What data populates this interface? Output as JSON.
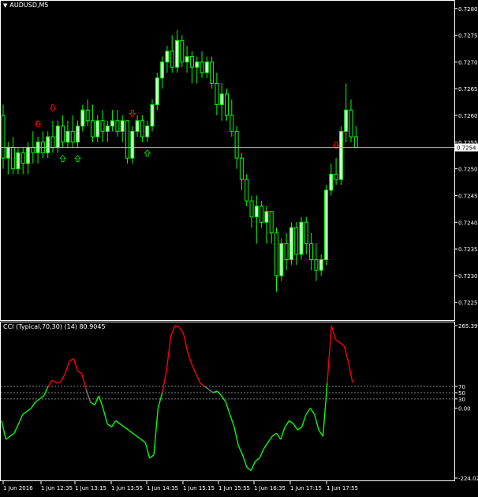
{
  "window": {
    "symbol_label": "AUDUSD,M5",
    "indicator_label": "CCI (Typical,70,30) (14) 80.9045",
    "current_price": "0.7254"
  },
  "colors": {
    "background": "#000000",
    "bull_candle": "#ccffcc",
    "bear_candle": "#000000",
    "wick": "#00ff00",
    "cci_low": "#00ff00",
    "cci_high": "#ff0000",
    "cci_mid": "#808080",
    "grid": "#ffffff",
    "arrow_up": "#00cc00",
    "arrow_down": "#ff0000"
  },
  "icons": {
    "up_arrow": "arrow-up-outline-icon",
    "down_arrow": "arrow-down-outline-icon"
  },
  "price_axis": [
    "0.7280",
    "0.7275",
    "0.7270",
    "0.7265",
    "0.7260",
    "0.7255",
    "0.7250",
    "0.7245",
    "0.7240",
    "0.7235",
    "0.7230",
    "0.7225"
  ],
  "cci_axis": [
    "265.3926",
    "70",
    "50",
    "30",
    "0.00",
    "-224.0247"
  ],
  "time_axis": [
    "1 Jun 2016",
    "1 Jun 12:35",
    "1 Jun 13:15",
    "1 Jun 13:55",
    "1 Jun 14:35",
    "1 Jun 15:15",
    "1 Jun 15:55",
    "1 Jun 16:35",
    "1 Jun 17:15",
    "1 Jun 17:55"
  ],
  "chart_data": [
    {
      "type": "candlestick",
      "symbol": "AUDUSD",
      "timeframe": "M5",
      "ylim": [
        0.7222,
        0.7281
      ],
      "current_price": 0.7254,
      "candles": [
        [
          0.726,
          0.7262,
          0.725,
          0.7252
        ],
        [
          0.7252,
          0.7255,
          0.7249,
          0.7254
        ],
        [
          0.7254,
          0.7256,
          0.7249,
          0.725
        ],
        [
          0.725,
          0.7254,
          0.7249,
          0.7253
        ],
        [
          0.7253,
          0.7254,
          0.7249,
          0.7251
        ],
        [
          0.7251,
          0.7255,
          0.7249,
          0.7254
        ],
        [
          0.7254,
          0.7257,
          0.7251,
          0.7253
        ],
        [
          0.7253,
          0.7256,
          0.7251,
          0.7255
        ],
        [
          0.7255,
          0.7257,
          0.7252,
          0.7253
        ],
        [
          0.7253,
          0.7257,
          0.7252,
          0.7256
        ],
        [
          0.7256,
          0.7259,
          0.7253,
          0.7254
        ],
        [
          0.7254,
          0.7259,
          0.7253,
          0.7258
        ],
        [
          0.7258,
          0.726,
          0.7254,
          0.7255
        ],
        [
          0.7255,
          0.7259,
          0.7254,
          0.7257
        ],
        [
          0.7257,
          0.726,
          0.7254,
          0.7255
        ],
        [
          0.7255,
          0.7259,
          0.7254,
          0.7258
        ],
        [
          0.7258,
          0.7262,
          0.7257,
          0.7261
        ],
        [
          0.7261,
          0.7263,
          0.7258,
          0.7259
        ],
        [
          0.7259,
          0.7262,
          0.7255,
          0.7256
        ],
        [
          0.7256,
          0.726,
          0.7255,
          0.7259
        ],
        [
          0.7259,
          0.7261,
          0.7255,
          0.7257
        ],
        [
          0.7257,
          0.7259,
          0.7255,
          0.7258
        ],
        [
          0.7258,
          0.7261,
          0.7257,
          0.7259
        ],
        [
          0.7259,
          0.7261,
          0.7256,
          0.7257
        ],
        [
          0.7257,
          0.726,
          0.7255,
          0.7259
        ],
        [
          0.7259,
          0.7259,
          0.7251,
          0.7252
        ],
        [
          0.7252,
          0.7258,
          0.7251,
          0.7257
        ],
        [
          0.7257,
          0.726,
          0.7256,
          0.7259
        ],
        [
          0.7259,
          0.726,
          0.7255,
          0.7256
        ],
        [
          0.7256,
          0.7259,
          0.7255,
          0.7258
        ],
        [
          0.7258,
          0.7263,
          0.7257,
          0.7262
        ],
        [
          0.7262,
          0.7268,
          0.7261,
          0.7267
        ],
        [
          0.7267,
          0.7271,
          0.7265,
          0.727
        ],
        [
          0.727,
          0.7273,
          0.7268,
          0.7272
        ],
        [
          0.7272,
          0.7275,
          0.7268,
          0.7269
        ],
        [
          0.7269,
          0.7276,
          0.7268,
          0.7274
        ],
        [
          0.7274,
          0.7275,
          0.7269,
          0.727
        ],
        [
          0.727,
          0.7273,
          0.7268,
          0.7271
        ],
        [
          0.7271,
          0.7272,
          0.7266,
          0.7269
        ],
        [
          0.7269,
          0.7271,
          0.7266,
          0.727
        ],
        [
          0.727,
          0.7272,
          0.7267,
          0.7268
        ],
        [
          0.7268,
          0.7271,
          0.7267,
          0.727
        ],
        [
          0.727,
          0.7271,
          0.7265,
          0.7266
        ],
        [
          0.7266,
          0.7268,
          0.726,
          0.7262
        ],
        [
          0.7262,
          0.7266,
          0.7259,
          0.7264
        ],
        [
          0.7264,
          0.7265,
          0.7259,
          0.726
        ],
        [
          0.726,
          0.7263,
          0.7256,
          0.7257
        ],
        [
          0.7257,
          0.7258,
          0.725,
          0.7252
        ],
        [
          0.7252,
          0.7253,
          0.7246,
          0.7248
        ],
        [
          0.7248,
          0.7249,
          0.7243,
          0.7244
        ],
        [
          0.7244,
          0.7245,
          0.7239,
          0.7241
        ],
        [
          0.7241,
          0.7245,
          0.7236,
          0.7243
        ],
        [
          0.7243,
          0.7244,
          0.7239,
          0.724
        ],
        [
          0.724,
          0.7243,
          0.7236,
          0.7242
        ],
        [
          0.7242,
          0.7242,
          0.7236,
          0.7238
        ],
        [
          0.7238,
          0.7239,
          0.7227,
          0.723
        ],
        [
          0.723,
          0.7237,
          0.7229,
          0.7236
        ],
        [
          0.7236,
          0.7238,
          0.7231,
          0.7233
        ],
        [
          0.7233,
          0.724,
          0.7232,
          0.7239
        ],
        [
          0.7239,
          0.724,
          0.7232,
          0.7234
        ],
        [
          0.7234,
          0.7241,
          0.7233,
          0.724
        ],
        [
          0.724,
          0.7241,
          0.7234,
          0.7236
        ],
        [
          0.7236,
          0.7238,
          0.7231,
          0.7233
        ],
        [
          0.7233,
          0.7236,
          0.7229,
          0.7231
        ],
        [
          0.7231,
          0.7234,
          0.723,
          0.7233
        ],
        [
          0.7233,
          0.7247,
          0.7232,
          0.7246
        ],
        [
          0.7246,
          0.7251,
          0.7245,
          0.7249
        ],
        [
          0.7249,
          0.7252,
          0.7247,
          0.7248
        ],
        [
          0.7248,
          0.7258,
          0.7247,
          0.7257
        ],
        [
          0.7257,
          0.7266,
          0.7255,
          0.7261
        ],
        [
          0.7261,
          0.7263,
          0.7255,
          0.7256
        ],
        [
          0.7256,
          0.7258,
          0.7254,
          0.7254
        ]
      ],
      "up_arrow_bars": [
        12,
        15,
        29
      ],
      "down_arrow_bars": [
        7,
        10,
        26,
        67
      ]
    },
    {
      "type": "line",
      "title": "CCI (Typical,70,30) (14) 80.9045",
      "ylim": [
        -224.0247,
        265.3926
      ],
      "levels": [
        70,
        50,
        30,
        0
      ],
      "values": [
        -40,
        -100,
        -90,
        -80,
        -50,
        -20,
        -10,
        0,
        20,
        30,
        40,
        70,
        90,
        80,
        85,
        110,
        150,
        160,
        120,
        110,
        60,
        20,
        10,
        40,
        0,
        -50,
        -60,
        -40,
        -50,
        -60,
        -70,
        -80,
        -90,
        -100,
        -110,
        -160,
        -150,
        0,
        50,
        120,
        230,
        265,
        260,
        240,
        180,
        140,
        110,
        80,
        70,
        60,
        50,
        55,
        40,
        20,
        -20,
        -60,
        -120,
        -150,
        -190,
        -200,
        -170,
        -160,
        -130,
        -110,
        -90,
        -80,
        -100,
        -60,
        -40,
        -50,
        -70,
        -60,
        -20,
        0,
        -20,
        -70,
        -90,
        80,
        265,
        220,
        210,
        200,
        150,
        80.9
      ]
    }
  ]
}
